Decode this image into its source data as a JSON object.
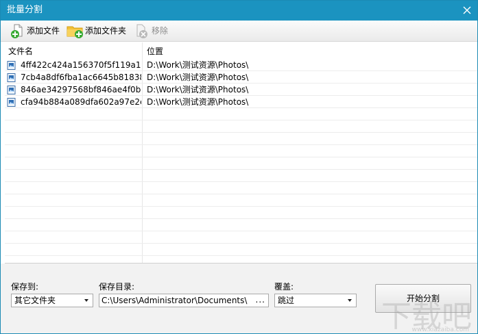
{
  "window": {
    "title": "批量分割"
  },
  "toolbar": {
    "add_file": "添加文件",
    "add_folder": "添加文件夹",
    "remove": "移除"
  },
  "list": {
    "col_name": "文件名",
    "col_path": "位置",
    "rows": [
      {
        "name": "4ff422c424a156370f5f119a1...",
        "path": "D:\\Work\\测试资源\\Photos\\"
      },
      {
        "name": "7cb4a8df6fba1ac6645b81838...",
        "path": "D:\\Work\\测试资源\\Photos\\"
      },
      {
        "name": "846ae34297568bf846ae4f0b...",
        "path": "D:\\Work\\测试资源\\Photos\\"
      },
      {
        "name": "cfa94b884a089dfa602a97e2e...",
        "path": "D:\\Work\\测试资源\\Photos\\"
      }
    ]
  },
  "bottom": {
    "save_to_label": "保存到:",
    "save_to_value": "其它文件夹",
    "save_dir_label": "保存目录:",
    "save_dir_value": "C:\\Users\\Administrator\\Documents\\",
    "browse_label": "...",
    "overwrite_label": "覆盖:",
    "overwrite_value": "跳过",
    "start_button": "开始分割"
  },
  "watermark": {
    "text": "下载吧",
    "url": "www.xiazaiba.com"
  },
  "icons": {
    "close": "close-icon",
    "add_file": "add-file-icon",
    "add_folder": "add-folder-icon",
    "remove": "remove-icon",
    "file": "image-file-icon"
  },
  "colors": {
    "titlebar": "#1b93c0",
    "accent_green": "#3aaa35",
    "folder_yellow": "#f3c23a"
  }
}
